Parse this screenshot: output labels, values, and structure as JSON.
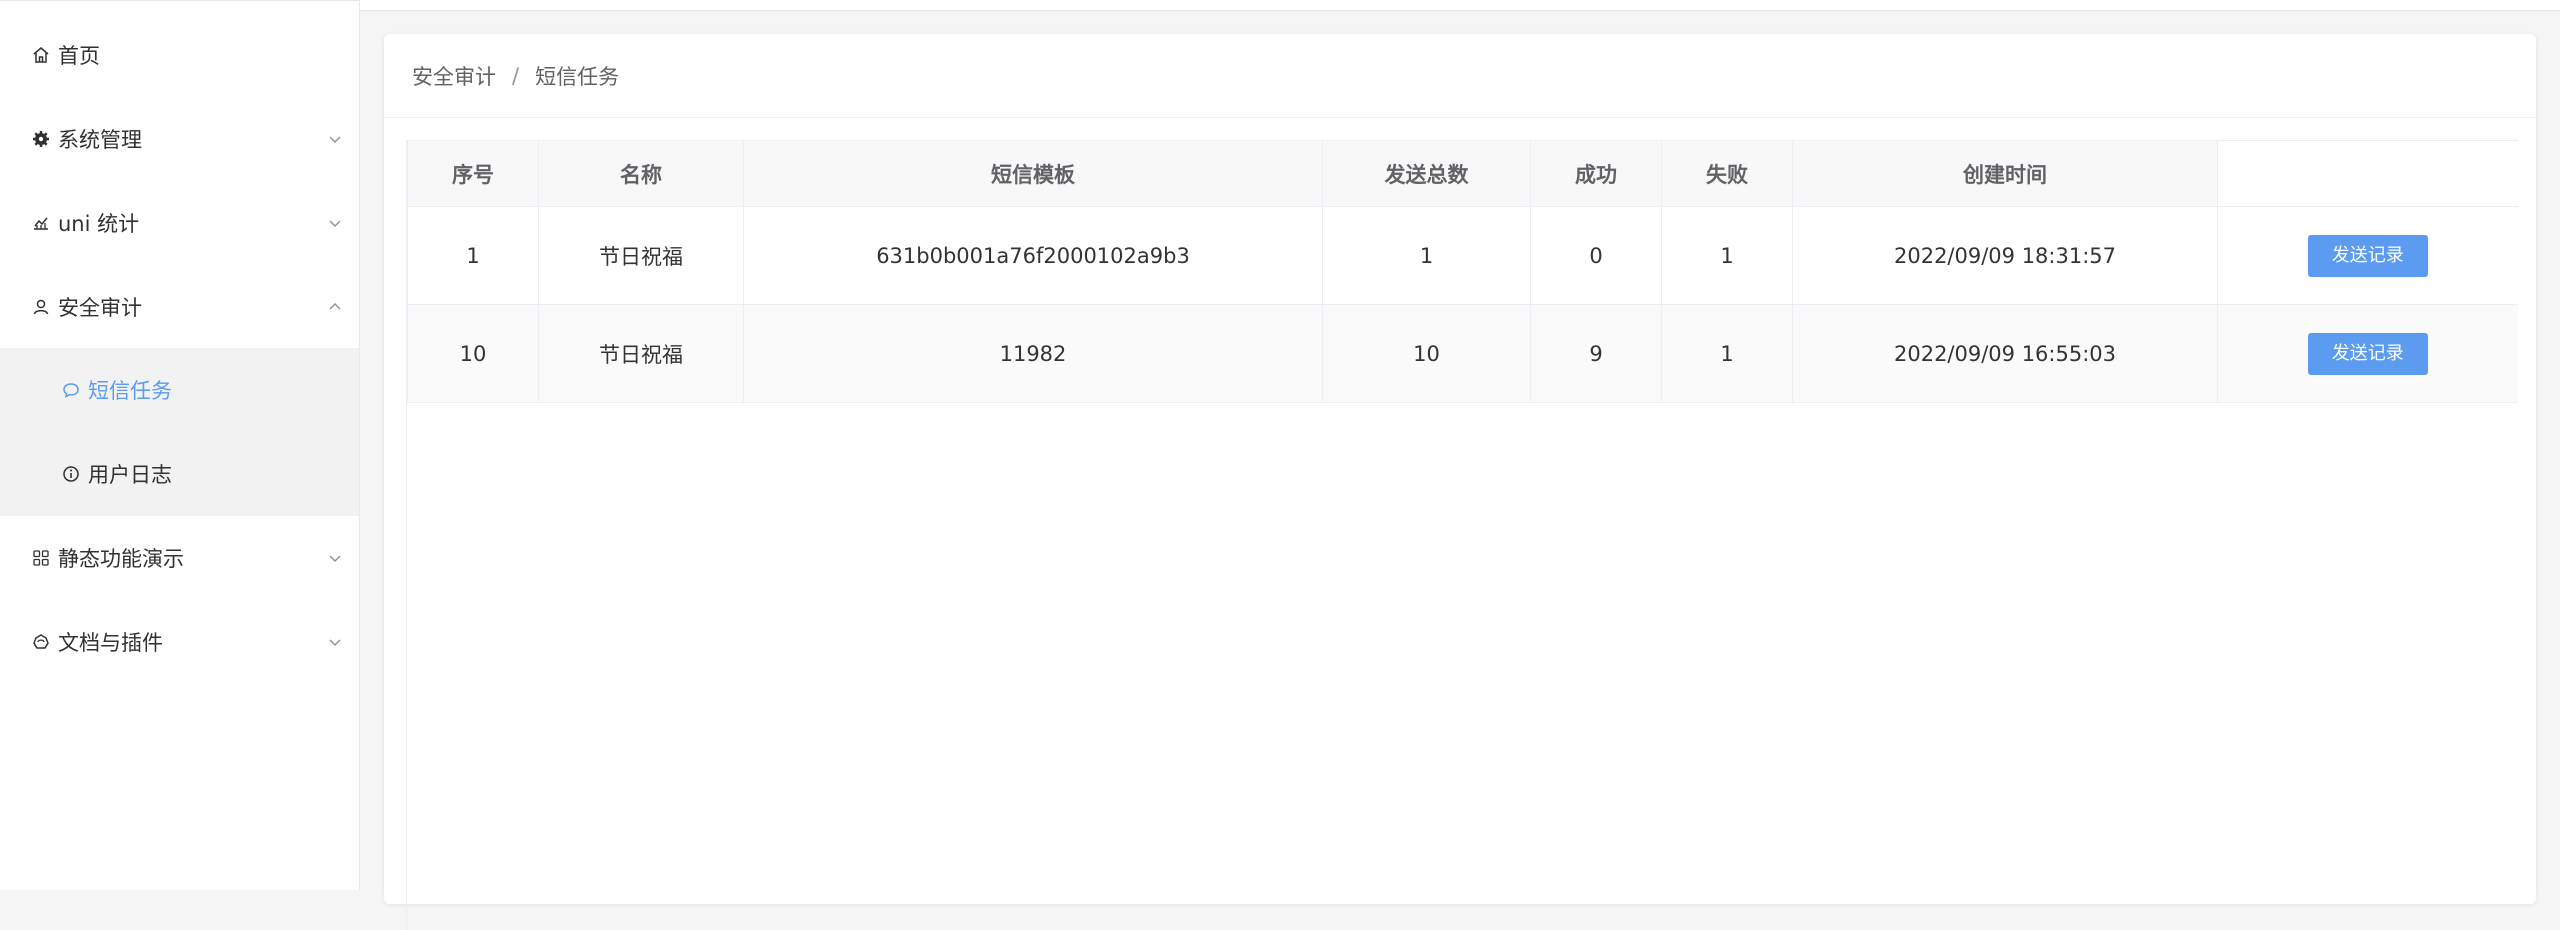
{
  "sidebar": {
    "items": [
      {
        "label": "首页",
        "icon": "home-icon"
      },
      {
        "label": "系统管理",
        "icon": "gear-icon"
      },
      {
        "label": "uni 统计",
        "icon": "chart-icon"
      },
      {
        "label": "安全审计",
        "icon": "user-icon"
      },
      {
        "label": "静态功能演示",
        "icon": "grid-icon"
      },
      {
        "label": "文档与插件",
        "icon": "plugin-icon"
      }
    ],
    "sub_items": [
      {
        "label": "短信任务",
        "icon": "message-icon",
        "active": true
      },
      {
        "label": "用户日志",
        "icon": "info-icon",
        "active": false
      }
    ]
  },
  "breadcrumb": {
    "parent": "安全审计",
    "separator": "/",
    "current": "短信任务"
  },
  "table": {
    "columns": [
      "序号",
      "名称",
      "短信模板",
      "发送总数",
      "成功",
      "失败",
      "创建时间",
      ""
    ],
    "rows": [
      {
        "index": "1",
        "name": "节日祝福",
        "template": "631b0b001a76f2000102a9b3",
        "total": "1",
        "success": "0",
        "fail": "1",
        "created": "2022/09/09 18:31:57",
        "action": "发送记录"
      },
      {
        "index": "10",
        "name": "节日祝福",
        "template": "11982",
        "total": "10",
        "success": "9",
        "fail": "1",
        "created": "2022/09/09 16:55:03",
        "action": "发送记录"
      }
    ]
  },
  "colors": {
    "accent": "#5b9bf0",
    "submenu_bg": "#f2f2f2"
  }
}
